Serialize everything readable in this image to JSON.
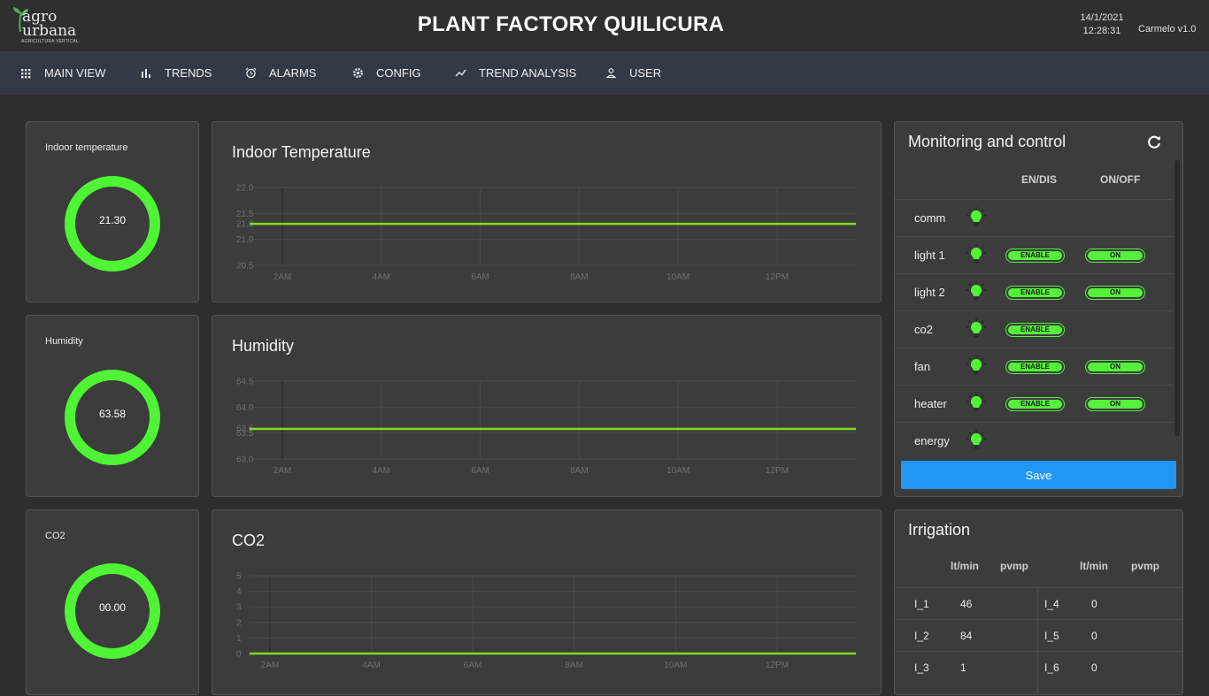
{
  "header": {
    "logo": {
      "line1": "agro",
      "line2": "urbana",
      "tagline": "AGRICULTURA VERTICAL"
    },
    "title": "PLANT FACTORY QUILICURA",
    "date": "14/1/2021",
    "time": "12:28:31",
    "user_version": "Carmelo v1.0"
  },
  "nav": [
    {
      "label": "MAIN VIEW",
      "icon": "grid-icon"
    },
    {
      "label": "TRENDS",
      "icon": "bar-chart-icon"
    },
    {
      "label": "ALARMS",
      "icon": "alarm-clock-icon"
    },
    {
      "label": "CONFIG",
      "icon": "gear-icon"
    },
    {
      "label": "TREND ANALYSIS",
      "icon": "trend-line-icon"
    },
    {
      "label": "USER",
      "icon": "user-icon"
    }
  ],
  "gauges": [
    {
      "label": "Indoor temperature",
      "value": "21.30"
    },
    {
      "label": "Humidity",
      "value": "63.58"
    },
    {
      "label": "CO2",
      "value": "00.00"
    }
  ],
  "colors": {
    "accent_green": "#4ff535",
    "line_green": "#7ddc1f",
    "save_blue": "#2196f3",
    "nav_bg": "#323a46"
  },
  "chart_data": [
    {
      "type": "line",
      "title": "Indoor Temperature",
      "x_ticks": [
        "2AM",
        "4AM",
        "6AM",
        "8AM",
        "10AM",
        "12PM"
      ],
      "y_ticks": [
        "22.0",
        "21.5",
        "21.3",
        "21.0",
        "20.5"
      ],
      "ylim": [
        20.5,
        22.0
      ],
      "series": [
        {
          "values": [
            21.3,
            21.3,
            21.3,
            21.3,
            21.3,
            21.3,
            21.3
          ]
        }
      ],
      "grid": true
    },
    {
      "type": "line",
      "title": "Humidity",
      "x_ticks": [
        "2AM",
        "4AM",
        "6AM",
        "8AM",
        "10AM",
        "12PM"
      ],
      "y_ticks": [
        "64.5",
        "64.0",
        "63.6",
        "63.5",
        "63.0"
      ],
      "ylim": [
        63.0,
        64.5
      ],
      "series": [
        {
          "values": [
            63.58,
            63.58,
            63.58,
            63.58,
            63.58,
            63.58,
            63.58
          ]
        }
      ],
      "grid": true
    },
    {
      "type": "line",
      "title": "CO2",
      "x_ticks": [
        "2AM",
        "4AM",
        "6AM",
        "8AM",
        "10AM",
        "12PM"
      ],
      "y_ticks": [
        "5",
        "4",
        "3",
        "2",
        "1",
        "0"
      ],
      "ylim": [
        0,
        5
      ],
      "series": [
        {
          "values": [
            0,
            0,
            0,
            0,
            0,
            0,
            0
          ]
        }
      ],
      "grid": true
    }
  ],
  "monitoring": {
    "title": "Monitoring and control",
    "col_endis": "EN/DIS",
    "col_onoff": "ON/OFF",
    "rows": [
      {
        "name": "comm",
        "enable": null,
        "onoff": null
      },
      {
        "name": "light 1",
        "enable": "ENABLE",
        "onoff": "ON"
      },
      {
        "name": "light 2",
        "enable": "ENABLE",
        "onoff": "ON"
      },
      {
        "name": "co2",
        "enable": "ENABLE",
        "onoff": null
      },
      {
        "name": "fan",
        "enable": "ENABLE",
        "onoff": "ON"
      },
      {
        "name": "heater",
        "enable": "ENABLE",
        "onoff": "ON"
      },
      {
        "name": "energy",
        "enable": null,
        "onoff": null
      }
    ],
    "save_label": "Save"
  },
  "irrigation": {
    "title": "Irrigation",
    "headers": {
      "ltmin": "lt/min",
      "pvmp": "pvmp"
    },
    "rows": [
      {
        "left_name": "I_1",
        "left_value": "46",
        "right_name": "I_4",
        "right_value": "0"
      },
      {
        "left_name": "I_2",
        "left_value": "84",
        "right_name": "I_5",
        "right_value": "0"
      },
      {
        "left_name": "I_3",
        "left_value": "1",
        "right_name": "I_6",
        "right_value": "0"
      }
    ]
  }
}
